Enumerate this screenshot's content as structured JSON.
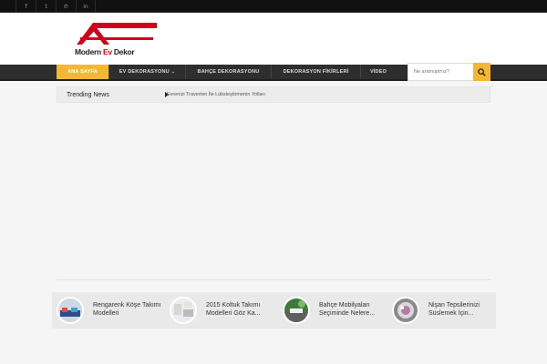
{
  "social": [
    {
      "icon": "facebook-icon",
      "glyph": "f"
    },
    {
      "icon": "tumblr-icon",
      "glyph": "t"
    },
    {
      "icon": "pinterest-icon",
      "glyph": "℗"
    },
    {
      "icon": "linkedin-icon",
      "glyph": "in"
    }
  ],
  "logo": {
    "part1": "Modern",
    "part2": " Ev ",
    "part3": "Dekor"
  },
  "nav": {
    "items": [
      {
        "label": "ANA SAYFA"
      },
      {
        "label": "EV DEKORASYONU",
        "chevron": "⌄"
      },
      {
        "label": "BAHÇE DEKORASYONU"
      },
      {
        "label": "DEKORASYON FİKİRLERİ"
      },
      {
        "label": "VİDEO"
      }
    ]
  },
  "search": {
    "placeholder": "Ne aramıştınız?"
  },
  "trending": {
    "label": "Trending News",
    "headline": "Evrenizi Traverten İle Lüksleştirmenin Yolları"
  },
  "slider": {
    "items": [
      {
        "title": "Rengarenk Köşe Takımı Modelleri"
      },
      {
        "title": "2015 Koltuk Takımı Modelleri Göz Ka..."
      },
      {
        "title": "Bahçe Mobilyaları Seçiminde Nelere..."
      },
      {
        "title": "Nişan Tepsilerinizi Süslemek İçin..."
      }
    ]
  },
  "colors": {
    "accent": "#f5b732",
    "nav_bg": "#2e2e2e",
    "logo_red": "#d0021b"
  }
}
